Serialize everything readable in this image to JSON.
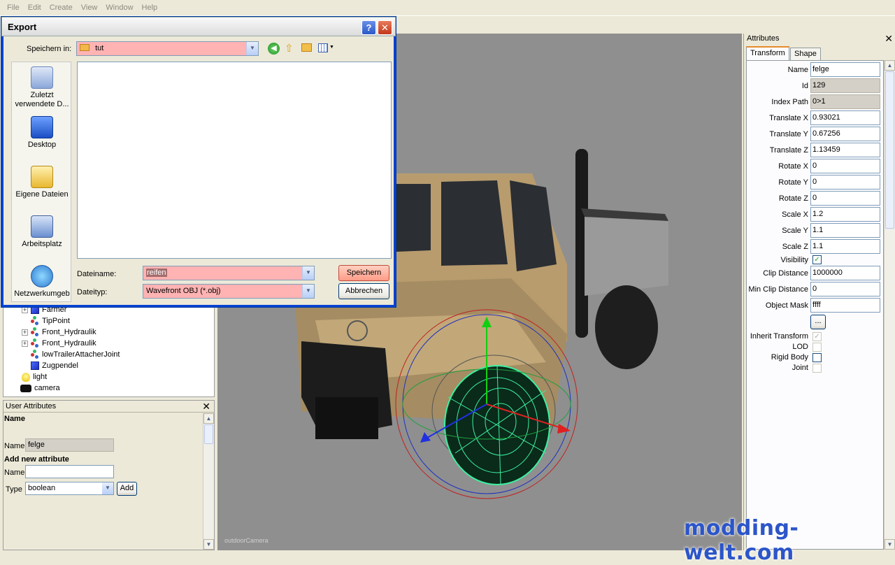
{
  "menu": [
    "File",
    "Edit",
    "Create",
    "View",
    "Window",
    "Help"
  ],
  "dialog": {
    "title": "Export",
    "help_label": "?",
    "close_label": "✕",
    "save_in_label": "Speichern in:",
    "save_in_value": "tut",
    "places": [
      {
        "label": "Zuletzt verwendete D...",
        "icon": "recent-documents-icon"
      },
      {
        "label": "Desktop",
        "icon": "desktop-icon"
      },
      {
        "label": "Eigene Dateien",
        "icon": "my-documents-icon"
      },
      {
        "label": "Arbeitsplatz",
        "icon": "my-computer-icon"
      },
      {
        "label": "Netzwerkumgeb",
        "icon": "network-icon"
      }
    ],
    "filename_label": "Dateiname:",
    "filename_value": "reifen",
    "filetype_label": "Dateityp:",
    "filetype_value": "Wavefront OBJ (*.obj)",
    "save_button": "Speichern",
    "cancel_button": "Abbrechen"
  },
  "scene_tree": {
    "items": [
      {
        "label": "Farmer",
        "icon": "cube-icon",
        "expandable": true
      },
      {
        "label": "TipPoint",
        "icon": "joint-icon",
        "expandable": false
      },
      {
        "label": "Front_Hydraulik",
        "icon": "joint-icon",
        "expandable": true
      },
      {
        "label": "Front_Hydraulik",
        "icon": "joint-icon",
        "expandable": true
      },
      {
        "label": "lowTrailerAttacherJoint",
        "icon": "joint-icon",
        "expandable": false
      },
      {
        "label": "Zugpendel",
        "icon": "cube-icon",
        "expandable": false
      },
      {
        "label": "light",
        "icon": "light-bulb-icon",
        "expandable": false
      },
      {
        "label": "camera",
        "icon": "camera-icon",
        "expandable": false
      }
    ]
  },
  "user_attributes": {
    "title": "User Attributes",
    "name_heading": "Name",
    "name_label": "Name",
    "name_value": "felge",
    "add_heading": "Add new attribute",
    "new_name_label": "Name",
    "new_name_value": "",
    "type_label": "Type",
    "type_value": "boolean",
    "add_button": "Add"
  },
  "viewport": {
    "camera_label": "outdoorCamera"
  },
  "attributes": {
    "title": "Attributes",
    "tabs": [
      "Transform",
      "Shape"
    ],
    "fields": [
      {
        "label": "Name",
        "value": "felge",
        "readonly": false
      },
      {
        "label": "Id",
        "value": "129",
        "readonly": true
      },
      {
        "label": "Index Path",
        "value": "0>1",
        "readonly": true
      },
      {
        "label": "Translate X",
        "value": "0.93021",
        "readonly": false
      },
      {
        "label": "Translate Y",
        "value": "0.67256",
        "readonly": false
      },
      {
        "label": "Translate Z",
        "value": "1.13459",
        "readonly": false
      },
      {
        "label": "Rotate X",
        "value": "0",
        "readonly": false
      },
      {
        "label": "Rotate Y",
        "value": "0",
        "readonly": false
      },
      {
        "label": "Rotate Z",
        "value": "0",
        "readonly": false
      },
      {
        "label": "Scale X",
        "value": "1.2",
        "readonly": false
      },
      {
        "label": "Scale Y",
        "value": "1.1",
        "readonly": false
      },
      {
        "label": "Scale Z",
        "value": "1.1",
        "readonly": false
      }
    ],
    "visibility_label": "Visibility",
    "visibility_checked": true,
    "clip_distance_label": "Clip Distance",
    "clip_distance_value": "1000000",
    "min_clip_distance_label": "Min Clip Distance",
    "min_clip_distance_value": "0",
    "object_mask_label": "Object Mask",
    "object_mask_value": "ffff",
    "more_button": "...",
    "checks": [
      {
        "label": "Inherit Transform",
        "checked": true,
        "disabled": true
      },
      {
        "label": "LOD",
        "checked": false,
        "disabled": true
      },
      {
        "label": "Rigid Body",
        "checked": false,
        "disabled": false
      },
      {
        "label": "Joint",
        "checked": false,
        "disabled": true
      }
    ]
  },
  "watermark": "modding-welt.com",
  "colors": {
    "xp_blue": "#0842d4",
    "error_highlight": "#ffb3b3",
    "wireframe": "#3cf0a0",
    "viewport_bg": "#8f8f8f"
  }
}
